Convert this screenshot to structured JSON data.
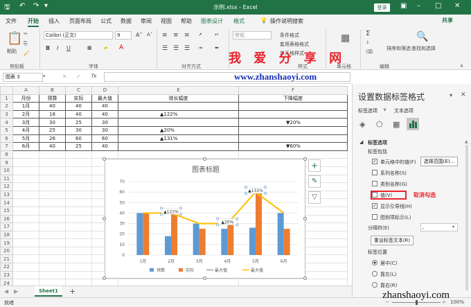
{
  "window": {
    "title": "示例.xlsx  -  Excel",
    "signin": "登录",
    "share": "共享",
    "search": "操作说明搜索"
  },
  "tabs": [
    "文件",
    "开始",
    "插入",
    "页面布局",
    "公式",
    "数据",
    "审阅",
    "视图",
    "帮助",
    "图表设计",
    "格式"
  ],
  "ribbon": {
    "paste": "粘贴",
    "clipboard": "剪贴板",
    "font_name": "Calibri (正文)",
    "font_size": "9",
    "font_group": "字体",
    "align_group": "对齐方式",
    "number_format": "常规",
    "cond_format": "条件格式",
    "table_format": "套用表格格式",
    "cell_style": "单元格样式",
    "style_group": "样式",
    "cells": "单元格",
    "edit": "编辑",
    "find": "查找和选择",
    "sort": "排序和筛选",
    "bold": "B",
    "italic": "I",
    "underline": "U"
  },
  "watermark": {
    "line1": "我 爱 分 享 网",
    "line2": "www.zhanshaoyi.com",
    "line3": "zhanshaoyi.com"
  },
  "formula": {
    "namebox": "图表 3",
    "fx": "fx"
  },
  "columns": [
    "A",
    "B",
    "C",
    "D",
    "E",
    "F"
  ],
  "rows": [
    [
      "月份",
      "预算",
      "实际",
      "最大值",
      "增长幅度",
      "下降幅度"
    ],
    [
      "1月",
      "40",
      "40",
      "40",
      "",
      ""
    ],
    [
      "2月",
      "18",
      "40",
      "40",
      "▲122%",
      ""
    ],
    [
      "3月",
      "30",
      "25",
      "30",
      "",
      "▼20%"
    ],
    [
      "4月",
      "25",
      "30",
      "30",
      "▲20%",
      ""
    ],
    [
      "5月",
      "26",
      "60",
      "60",
      "▲131%",
      ""
    ],
    [
      "6月",
      "40",
      "25",
      "40",
      "",
      "▼60%"
    ]
  ],
  "row_numbers": [
    "1",
    "2",
    "3",
    "4",
    "5",
    "6",
    "7",
    "8",
    "9",
    "10",
    "11",
    "12",
    "13",
    "14",
    "15",
    "16",
    "17",
    "18",
    "19",
    "20",
    "21",
    "22",
    "23",
    "24"
  ],
  "chart_data": {
    "type": "bar",
    "title": "图表标题",
    "categories": [
      "1月",
      "2月",
      "3月",
      "4月",
      "5月",
      "6月"
    ],
    "ylim": [
      0,
      70
    ],
    "yticks": [
      "0",
      "10",
      "20",
      "30",
      "40",
      "50",
      "60",
      "70"
    ],
    "series": [
      {
        "name": "预算",
        "type": "bar",
        "color": "#5b9bd5",
        "values": [
          40,
          18,
          30,
          25,
          26,
          40
        ]
      },
      {
        "name": "实际",
        "type": "bar",
        "color": "#ed7d31",
        "values": [
          40,
          40,
          25,
          30,
          60,
          25
        ]
      },
      {
        "name": "最大值",
        "type": "line",
        "color": "#a5a5a5",
        "values": [
          40,
          40,
          30,
          30,
          60,
          40
        ]
      },
      {
        "name": "最大值",
        "type": "line",
        "color": "#ffc000",
        "values": [
          40,
          40,
          30,
          30,
          60,
          40
        ]
      }
    ],
    "data_labels": [
      {
        "category": "2月",
        "text": "▲122%"
      },
      {
        "category": "4月",
        "text": "▲20%"
      },
      {
        "category": "5月",
        "text": "▲131%"
      }
    ],
    "legend": "bottom"
  },
  "sheet": {
    "tab": "Sheet1",
    "add": "+"
  },
  "status": {
    "ready": "就绪",
    "zoom": "100%"
  },
  "pane": {
    "title": "设置数据标签格式",
    "tab_options": "标签选项",
    "tab_text": "文本选项",
    "section": "标签选项",
    "contains": "标签包括",
    "items": [
      {
        "label": "单元格中的值(F)",
        "checked": true
      },
      {
        "label": "系列名称(S)",
        "checked": false
      },
      {
        "label": "类别名称(G)",
        "checked": false
      },
      {
        "label": "值(V)",
        "checked": false
      },
      {
        "label": "显示引导线(H)",
        "checked": true
      },
      {
        "label": "图例项标示(L)",
        "checked": false
      }
    ],
    "select_range": "选择范围(E)...",
    "annotation": "取消勾选",
    "separator_label": "分隔符(E)",
    "separator_value": ",",
    "reset": "重设标签文本(R)",
    "position_label": "标签位置",
    "positions": [
      {
        "label": "居中(C)",
        "selected": true
      },
      {
        "label": "靠左(L)",
        "selected": false
      },
      {
        "label": "靠右(R)",
        "selected": false
      }
    ]
  }
}
